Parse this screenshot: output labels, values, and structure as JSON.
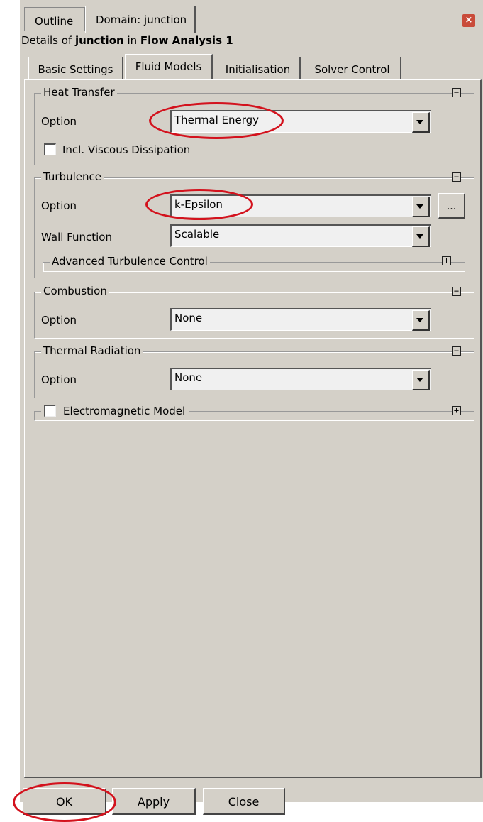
{
  "top_tabs": [
    {
      "label": "Outline"
    },
    {
      "label": "Domain: junction"
    }
  ],
  "details": {
    "prefix": "Details of ",
    "object": "junction",
    "middle": " in ",
    "analysis": "Flow Analysis 1"
  },
  "sub_tabs": [
    {
      "label": "Basic Settings"
    },
    {
      "label": "Fluid Models"
    },
    {
      "label": "Initialisation"
    },
    {
      "label": "Solver Control"
    }
  ],
  "heat_transfer": {
    "title": "Heat Transfer",
    "option_label": "Option",
    "option_value": "Thermal Energy",
    "checkbox_label": "Incl. Viscous Dissipation",
    "checked": false
  },
  "turbulence": {
    "title": "Turbulence",
    "option_label": "Option",
    "option_value": "k-Epsilon",
    "dots_label": "...",
    "wall_label": "Wall Function",
    "wall_value": "Scalable",
    "advanced_label": "Advanced Turbulence Control"
  },
  "combustion": {
    "title": "Combustion",
    "option_label": "Option",
    "option_value": "None"
  },
  "thermal_radiation": {
    "title": "Thermal Radiation",
    "option_label": "Option",
    "option_value": "None"
  },
  "electromagnetic": {
    "label": "Electromagnetic Model",
    "checked": false
  },
  "buttons": {
    "ok": "OK",
    "apply": "Apply",
    "close": "Close"
  },
  "collapse_symbols": {
    "minus": "−",
    "plus": "+"
  },
  "annotation_color": "#d3121d",
  "close_icon_glyph": "×"
}
